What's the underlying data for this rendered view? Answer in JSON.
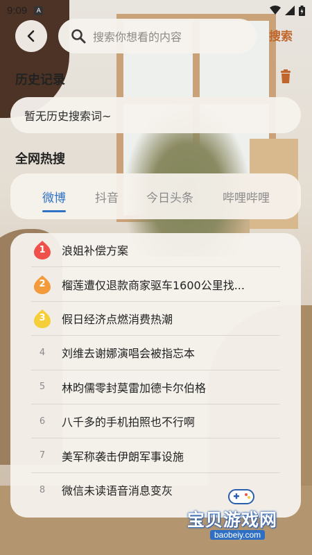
{
  "status_bar": {
    "time": "9:09",
    "notification_badge": "A"
  },
  "header": {
    "search_placeholder": "搜索你想看的内容",
    "search_button_label": "搜索"
  },
  "history": {
    "title": "历史记录",
    "empty_text": "暂无历史搜索词~"
  },
  "trending": {
    "title": "全网热搜",
    "tabs": [
      {
        "label": "微博",
        "active": true
      },
      {
        "label": "抖音",
        "active": false
      },
      {
        "label": "今日头条",
        "active": false
      },
      {
        "label": "哔哩哔哩",
        "active": false
      }
    ],
    "items": [
      {
        "rank": "1",
        "text": "浪姐补偿方案",
        "badge_color": "#f0504a"
      },
      {
        "rank": "2",
        "text": "榴莲遭仅退款商家驱车1600公里找...",
        "badge_color": "#f39a3b"
      },
      {
        "rank": "3",
        "text": "假日经济点燃消费热潮",
        "badge_color": "#f5cf3a"
      },
      {
        "rank": "4",
        "text": "刘维去谢娜演唱会被指忘本"
      },
      {
        "rank": "5",
        "text": "林昀儒零封莫雷加德卡尔伯格"
      },
      {
        "rank": "6",
        "text": "八千多的手机拍照也不行啊"
      },
      {
        "rank": "7",
        "text": "美军称袭击伊朗军事设施"
      },
      {
        "rank": "8",
        "text": "微信未读语音消息变灰"
      }
    ]
  },
  "watermark": {
    "name": "宝贝游戏网",
    "url": "baobeiy.com"
  },
  "colors": {
    "accent": "#c0662d",
    "tab_active": "#2f72c4"
  }
}
